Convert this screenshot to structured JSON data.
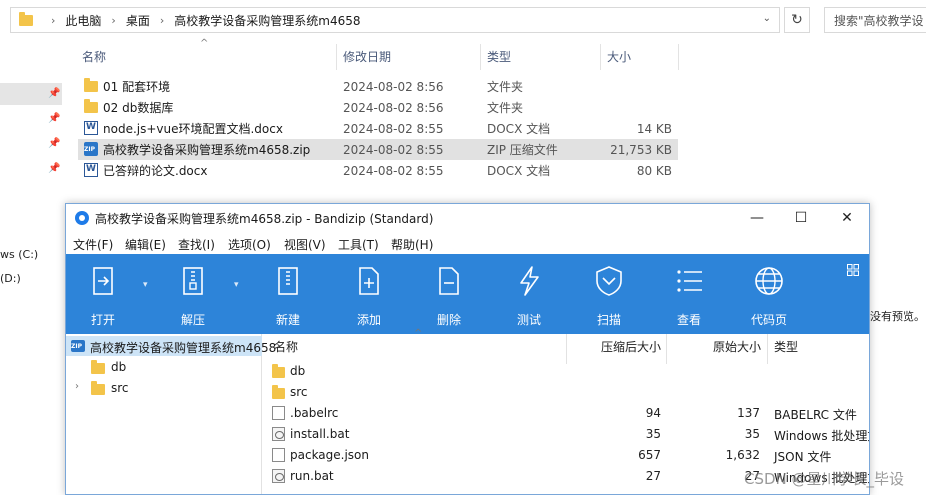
{
  "explorer": {
    "breadcrumb": [
      "此电脑",
      "桌面",
      "高校教学设备采购管理系统m4658"
    ],
    "search_placeholder": "搜索\"高校教学设",
    "columns": {
      "name": "名称",
      "date": "修改日期",
      "type": "类型",
      "size": "大小"
    },
    "nav_labels": [
      "ws (C:)",
      "(D:)"
    ],
    "files": [
      {
        "name": "01  配套环境",
        "date": "2024-08-02 8:56",
        "type": "文件夹",
        "size": "",
        "icon": "folder-icon"
      },
      {
        "name": "02 db数据库",
        "date": "2024-08-02 8:56",
        "type": "文件夹",
        "size": "",
        "icon": "folder-icon"
      },
      {
        "name": "node.js+vue环境配置文档.docx",
        "date": "2024-08-02 8:55",
        "type": "DOCX 文档",
        "size": "14 KB",
        "icon": "docx-icon"
      },
      {
        "name": "高校教学设备采购管理系统m4658.zip",
        "date": "2024-08-02 8:55",
        "type": "ZIP 压缩文件",
        "size": "21,753 KB",
        "icon": "zip-icon"
      },
      {
        "name": "已答辩的论文.docx",
        "date": "2024-08-02 8:55",
        "type": "DOCX 文档",
        "size": "80 KB",
        "icon": "docx-icon"
      }
    ],
    "preview_note": "没有预览。"
  },
  "bandizip": {
    "title": "高校教学设备采购管理系统m4658.zip - Bandizip (Standard)",
    "menu": [
      "文件(F)",
      "编辑(E)",
      "查找(I)",
      "选项(O)",
      "视图(V)",
      "工具(T)",
      "帮助(H)"
    ],
    "toolbar": [
      {
        "label": "打开",
        "icon": "open-icon"
      },
      {
        "label": "解压",
        "icon": "extract-icon"
      },
      {
        "label": "新建",
        "icon": "new-archive-icon"
      },
      {
        "label": "添加",
        "icon": "add-icon"
      },
      {
        "label": "删除",
        "icon": "delete-icon"
      },
      {
        "label": "测试",
        "icon": "test-icon"
      },
      {
        "label": "扫描",
        "icon": "scan-icon"
      },
      {
        "label": "查看",
        "icon": "view-icon"
      },
      {
        "label": "代码页",
        "icon": "codepage-icon"
      }
    ],
    "tree": {
      "root": "高校教学设备采购管理系统m4658",
      "items": [
        {
          "label": "db"
        },
        {
          "label": "src"
        }
      ]
    },
    "list_columns": {
      "name": "名称",
      "packed": "压缩后大小",
      "original": "原始大小",
      "type": "类型"
    },
    "list_rows": [
      {
        "name": "db",
        "packed": "",
        "original": "",
        "type": "",
        "icon": "folder-icon"
      },
      {
        "name": "src",
        "packed": "",
        "original": "",
        "type": "",
        "icon": "folder-icon"
      },
      {
        "name": ".babelrc",
        "packed": "94",
        "original": "137",
        "type": "BABELRC 文件",
        "icon": "file-icon"
      },
      {
        "name": "install.bat",
        "packed": "35",
        "original": "35",
        "type": "Windows 批处理文",
        "icon": "bat-icon"
      },
      {
        "name": "package.json",
        "packed": "657",
        "original": "1,632",
        "type": "JSON 文件",
        "icon": "file-icon"
      },
      {
        "name": "run.bat",
        "packed": "27",
        "original": "27",
        "type": "Windows 批处理文",
        "icon": "bat-icon"
      }
    ]
  },
  "watermark": "CSDN @星川学长_毕设",
  "colors": {
    "toolbar_blue": "#2d84d9",
    "folder_yellow": "#f3c44a",
    "tree_selected": "#cde4f7"
  }
}
